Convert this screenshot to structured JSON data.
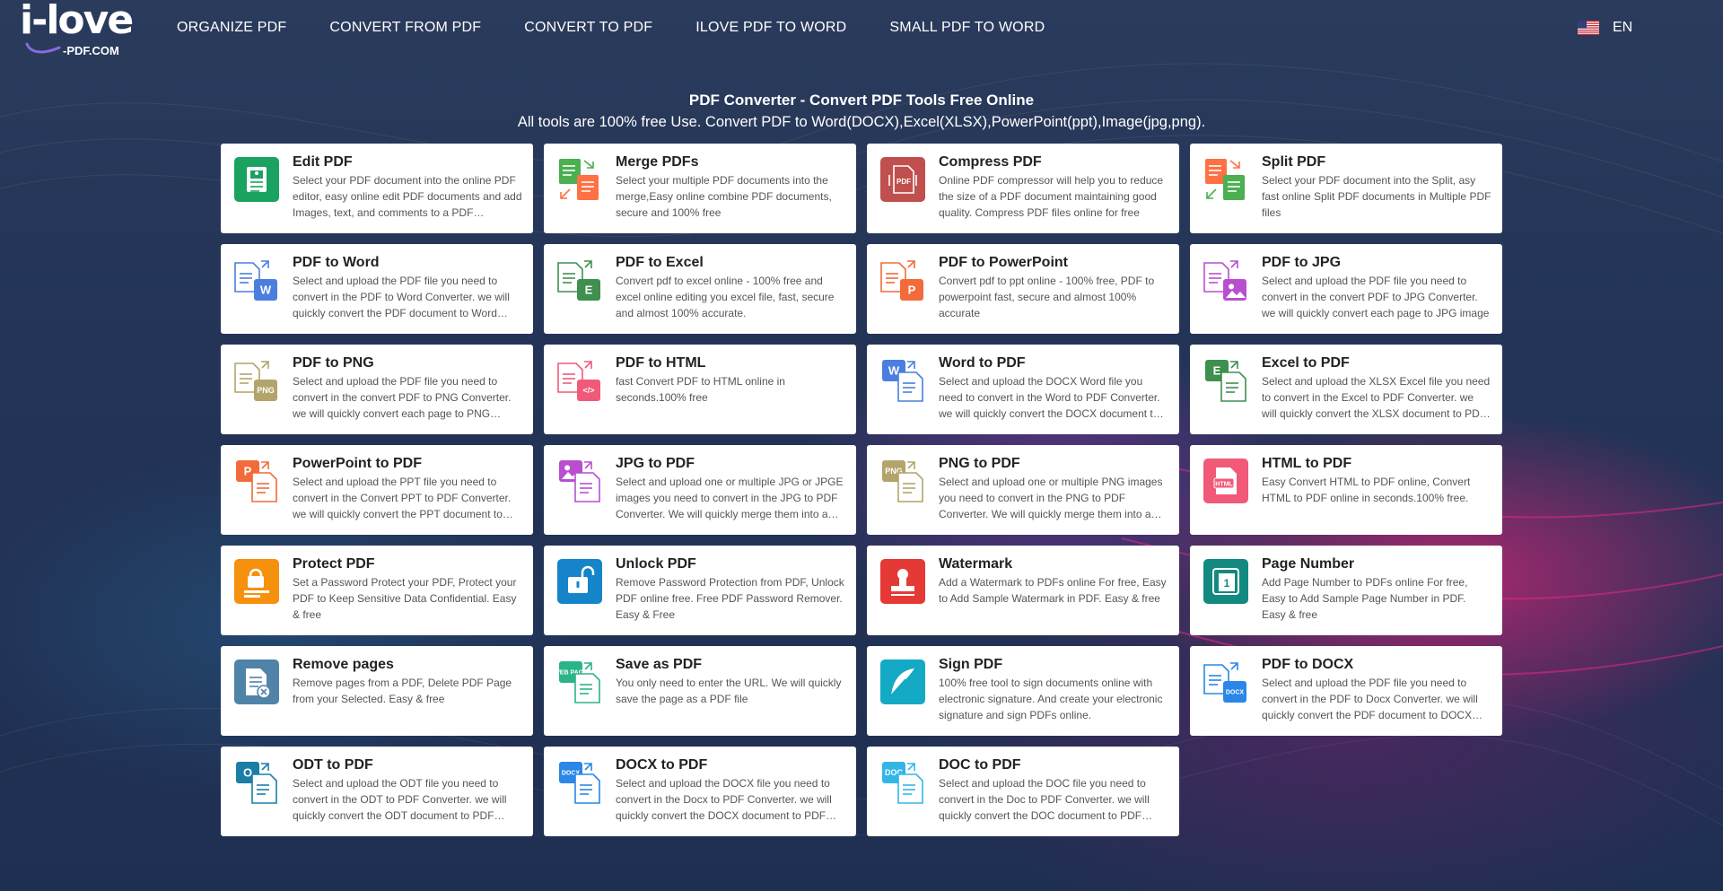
{
  "header": {
    "logo_main": "i-love",
    "logo_sub": "-PDF.COM",
    "nav": [
      {
        "label": "ORGANIZE PDF"
      },
      {
        "label": "CONVERT FROM PDF"
      },
      {
        "label": "CONVERT TO PDF"
      },
      {
        "label": "ILOVE PDF TO WORD"
      },
      {
        "label": "SMALL PDF TO WORD"
      }
    ],
    "language": "EN"
  },
  "intro": {
    "title": "PDF Converter - Convert PDF Tools Free Online",
    "subtitle": "All tools are 100% free Use. Convert PDF to Word(DOCX),Excel(XLSX),PowerPoint(ppt),Image(jpg,png)."
  },
  "tools": [
    {
      "id": "edit-pdf",
      "title": "Edit PDF",
      "desc": "Select your PDF document into the online PDF editor, easy online edit PDF documents and add Images, text, and comments to a PDF document",
      "icon": "edit-pdf-icon",
      "color": "#1aa260",
      "style": "solid"
    },
    {
      "id": "merge-pdfs",
      "title": "Merge PDFs",
      "desc": "Select your multiple PDF documents into the merge,Easy online combine PDF documents, secure and 100% free",
      "icon": "merge-icon",
      "color": "#4caf50",
      "color2": "#ff7043",
      "style": "doc2"
    },
    {
      "id": "compress-pdf",
      "title": "Compress PDF",
      "desc": "Online PDF compressor will help you to reduce the size of a PDF document maintaining good quality. Compress PDF files online for free",
      "icon": "compress-icon",
      "color": "#c0504d",
      "style": "solid"
    },
    {
      "id": "split-pdf",
      "title": "Split PDF",
      "desc": "Select your PDF document into the Split, asy fast online Split PDF documents in Multiple PDF files",
      "icon": "split-icon",
      "color": "#ff7043",
      "color2": "#4caf50",
      "style": "doc2"
    },
    {
      "id": "pdf-to-word",
      "title": "PDF to Word",
      "desc": "Select and upload the PDF file you need to convert in the PDF to Word Converter. we will quickly convert the PDF document to Word document",
      "icon": "pdf-to-word-icon",
      "color": "#4a7fe0",
      "badge": "W",
      "style": "doc"
    },
    {
      "id": "pdf-to-excel",
      "title": "PDF to Excel",
      "desc": "Convert pdf to excel online - 100% free and excel online editing you excel file, fast, secure and almost 100% accurate.",
      "icon": "pdf-to-excel-icon",
      "color": "#3f8f4e",
      "badge": "E",
      "style": "doc"
    },
    {
      "id": "pdf-to-powerpoint",
      "title": "PDF to PowerPoint",
      "desc": "Convert pdf to ppt online - 100% free, PDF to powerpoint fast, secure and almost 100% accurate",
      "icon": "pdf-to-ppt-icon",
      "color": "#f26b3a",
      "badge": "P",
      "style": "doc"
    },
    {
      "id": "pdf-to-jpg",
      "title": "PDF to JPG",
      "desc": "Select and upload the PDF file you need to convert in the convert PDF to JPG Converter. we will quickly convert each page to JPG image",
      "icon": "pdf-to-jpg-icon",
      "color": "#b94fd0",
      "badge": "img",
      "style": "doc"
    },
    {
      "id": "pdf-to-png",
      "title": "PDF to PNG",
      "desc": "Select and upload the PDF file you need to convert in the convert PDF to PNG Converter. we will quickly convert each page to PNG image",
      "icon": "pdf-to-png-icon",
      "color": "#b3a46a",
      "badge": "PNG",
      "style": "doc"
    },
    {
      "id": "pdf-to-html",
      "title": "PDF to HTML",
      "desc": "fast Convert PDF to HTML online in seconds.100% free",
      "icon": "pdf-to-html-icon",
      "color": "#f05a78",
      "badge": "</>",
      "style": "doc"
    },
    {
      "id": "word-to-pdf",
      "title": "Word to PDF",
      "desc": "Select and upload the DOCX Word file you need to convert in the Word to PDF Converter. we will quickly convert the DOCX document to PDF document",
      "icon": "word-to-pdf-icon",
      "color": "#4a7fe0",
      "badge": "W",
      "style": "doc-rev"
    },
    {
      "id": "excel-to-pdf",
      "title": "Excel to PDF",
      "desc": "Select and upload the XLSX Excel file you need to convert in the Excel to PDF Converter. we will quickly convert the XLSX document to PDF document",
      "icon": "excel-to-pdf-icon",
      "color": "#3f8f4e",
      "badge": "E",
      "style": "doc-rev"
    },
    {
      "id": "powerpoint-to-pdf",
      "title": "PowerPoint to PDF",
      "desc": "Select and upload the PPT file you need to convert in the Convert PPT to PDF Converter. we will quickly convert the PPT document to PDF document",
      "icon": "ppt-to-pdf-icon",
      "color": "#f26b3a",
      "badge": "P",
      "style": "doc-rev"
    },
    {
      "id": "jpg-to-pdf",
      "title": "JPG to PDF",
      "desc": "Select and upload one or multiple JPG or JPGE images you need to convert in the JPG to PDF Converter. We will quickly merge them into a PDF file",
      "icon": "jpg-to-pdf-icon",
      "color": "#b94fd0",
      "badge": "img",
      "style": "doc-rev"
    },
    {
      "id": "png-to-pdf",
      "title": "PNG to PDF",
      "desc": "Select and upload one or multiple PNG images you need to convert in the PNG to PDF Converter. We will quickly merge them into a PDF file",
      "icon": "png-to-pdf-icon",
      "color": "#b3a46a",
      "badge": "PNG",
      "style": "doc-rev"
    },
    {
      "id": "html-to-pdf",
      "title": "HTML to PDF",
      "desc": "Easy Convert HTML to PDF online, Convert HTML to PDF online in seconds.100% free.",
      "icon": "html-to-pdf-icon",
      "color": "#f05a78",
      "badge": "HTML",
      "style": "solid"
    },
    {
      "id": "protect-pdf",
      "title": "Protect PDF",
      "desc": "Set a Password Protect your PDF, Protect your PDF to Keep Sensitive Data Confidential. Easy & free",
      "icon": "lock-icon",
      "color": "#f5910d",
      "style": "solid"
    },
    {
      "id": "unlock-pdf",
      "title": "Unlock PDF",
      "desc": "Remove Password Protection from PDF, Unlock PDF online free. Free PDF Password Remover. Easy & Free",
      "icon": "unlock-icon",
      "color": "#1584c9",
      "style": "solid"
    },
    {
      "id": "watermark",
      "title": "Watermark",
      "desc": "Add a Watermark to PDFs online For free, Easy to Add Sample Watermark in PDF. Easy & free",
      "icon": "stamp-icon",
      "color": "#e53935",
      "style": "solid"
    },
    {
      "id": "page-number",
      "title": "Page Number",
      "desc": "Add Page Number to PDFs online For free, Easy to Add Sample Page Number in PDF. Easy & free",
      "icon": "page-number-icon",
      "color": "#138a80",
      "style": "solid"
    },
    {
      "id": "remove-pages",
      "title": "Remove pages",
      "desc": "Remove pages from a PDF, Delete PDF Page from your Selected. Easy & free",
      "icon": "remove-pages-icon",
      "color": "#4f83a8",
      "style": "solid"
    },
    {
      "id": "save-as-pdf",
      "title": "Save as PDF",
      "desc": "You only need to enter the URL. We will quickly save the page as a PDF file",
      "icon": "webpage-icon",
      "color": "#2bb38a",
      "badge": "WEB PAGE",
      "style": "doc-rev"
    },
    {
      "id": "sign-pdf",
      "title": "Sign PDF",
      "desc": "100% free tool to sign documents online with electronic signature. And create your electronic signature and sign PDFs online.",
      "icon": "feather-pen-icon",
      "color": "#14a9c4",
      "style": "solid"
    },
    {
      "id": "pdf-to-docx",
      "title": "PDF to DOCX",
      "desc": "Select and upload the PDF file you need to convert in the PDF to Docx Converter. we will quickly convert the PDF document to DOCX document",
      "icon": "pdf-to-docx-icon",
      "color": "#2a87e6",
      "badge": "DOCX",
      "style": "doc"
    },
    {
      "id": "odt-to-pdf",
      "title": "ODT to PDF",
      "desc": "Select and upload the ODT file you need to convert in the ODT to PDF Converter. we will quickly convert the ODT document to PDF document",
      "icon": "odt-to-pdf-icon",
      "color": "#1b7ea6",
      "badge": "O",
      "style": "doc-rev"
    },
    {
      "id": "docx-to-pdf",
      "title": "DOCX to PDF",
      "desc": "Select and upload the DOCX file you need to convert in the Docx to PDF Converter. we will quickly convert the DOCX document to PDF document",
      "icon": "docx-to-pdf-icon",
      "color": "#2a87e6",
      "badge": "DOCX",
      "style": "doc-rev"
    },
    {
      "id": "doc-to-pdf",
      "title": "DOC to PDF",
      "desc": "Select and upload the DOC file you need to convert in the Doc to PDF Converter. we will quickly convert the DOC document to PDF document",
      "icon": "doc-to-pdf-icon",
      "color": "#33b5e8",
      "badge": "DOC",
      "style": "doc-rev"
    }
  ]
}
